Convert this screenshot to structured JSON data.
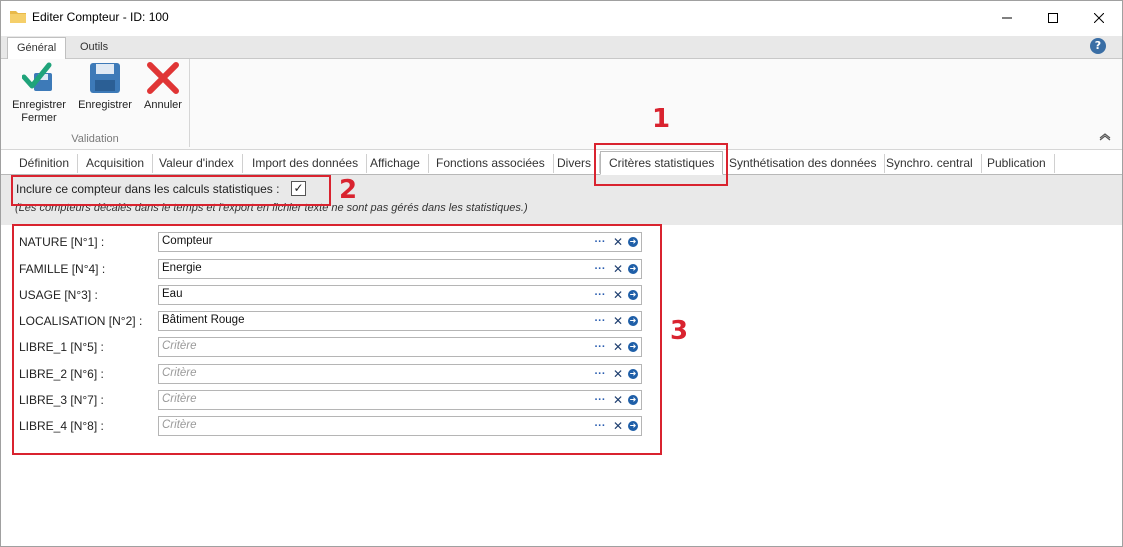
{
  "window": {
    "title": "Editer Compteur - ID: 100"
  },
  "ribbon": {
    "tabs": [
      "Général",
      "Outils"
    ],
    "buttons": [
      {
        "label_line1": "Enregistrer",
        "label_line2": "Fermer",
        "icon": "save-close-icon"
      },
      {
        "label_line1": "Enregistrer",
        "label_line2": "",
        "icon": "save-icon"
      },
      {
        "label_line1": "Annuler",
        "label_line2": "",
        "icon": "cancel-icon"
      }
    ],
    "group_label": "Validation"
  },
  "page_tabs": [
    "Définition",
    "Acquisition",
    "Valeur d'index",
    "Import des données",
    "Affichage",
    "Fonctions associées",
    "Divers",
    "Critères statistiques",
    "Synthétisation des données",
    "Synchro. central",
    "Publication"
  ],
  "active_tab": "Critères statistiques",
  "include": {
    "label": "Inclure ce compteur dans les calculs statistiques :",
    "checked": true,
    "check_glyph": "✓",
    "note": "(Les compteurs décalés dans le temps et l'export en fichier texte ne sont pas gérés dans les statistiques.)"
  },
  "criteria": [
    {
      "label": "NATURE [N°1] :",
      "value": "Compteur",
      "placeholder": ""
    },
    {
      "label": "FAMILLE [N°4] :",
      "value": "Energie",
      "placeholder": ""
    },
    {
      "label": "USAGE [N°3] :",
      "value": "Eau",
      "placeholder": ""
    },
    {
      "label": "LOCALISATION [N°2] :",
      "value": "Bâtiment Rouge",
      "placeholder": ""
    },
    {
      "label": "LIBRE_1 [N°5] :",
      "value": "",
      "placeholder": "Critère"
    },
    {
      "label": "LIBRE_2 [N°6] :",
      "value": "",
      "placeholder": "Critère"
    },
    {
      "label": "LIBRE_3 [N°7] :",
      "value": "",
      "placeholder": "Critère"
    },
    {
      "label": "LIBRE_4 [N°8] :",
      "value": "",
      "placeholder": "Critère"
    }
  ],
  "field_buttons": {
    "dots": "···",
    "clear": "✕",
    "go": "➜"
  },
  "annotations": [
    "1",
    "2",
    "3"
  ],
  "colors": {
    "annotation": "#d9232f",
    "accent": "#1f5fa8"
  }
}
